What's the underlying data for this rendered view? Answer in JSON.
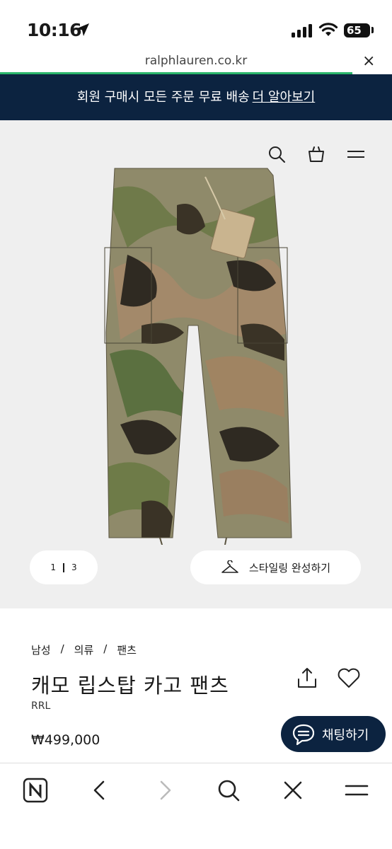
{
  "status_bar": {
    "time": "10:16",
    "battery": "65"
  },
  "browser": {
    "url": "ralphlauren.co.kr",
    "close_label": "×"
  },
  "promo_banner": {
    "text": "회원 구매시 모든 주문 무료 배송",
    "link": "더 알아보기",
    "bg_color": "#0c2340"
  },
  "header_icons": [
    "search-icon",
    "shopping-bag-icon",
    "menu-icon"
  ],
  "gallery": {
    "page_current": "1",
    "page_total": "3",
    "styling_button": "스타일링 완성하기"
  },
  "product": {
    "breadcrumb": [
      "남성",
      "/",
      "의류",
      "/",
      "팬츠"
    ],
    "title": "캐모 립스탑 카고 팬츠",
    "brand": "RRL",
    "price": "₩499,000"
  },
  "chat_button": {
    "label": "채팅하기"
  },
  "toolbar": [
    "naver-icon",
    "back-icon",
    "forward-icon",
    "search-icon",
    "close-icon",
    "menu-icon"
  ]
}
